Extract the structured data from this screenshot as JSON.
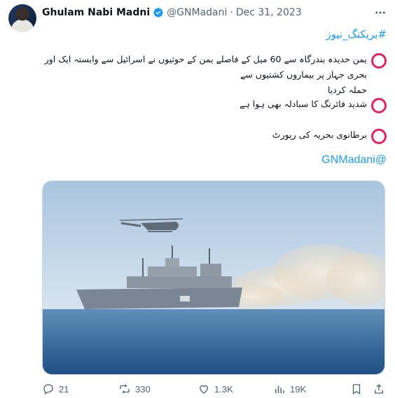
{
  "post": {
    "author_name": "Ghulam Nabi Madni",
    "handle": "@GNMadani",
    "separator": "·",
    "date": "Dec 31, 2023",
    "hashtag": "#بریکنگ_نیوز",
    "lines": [
      "یمن حدیدہ بندرگاہ سے 60 میل کے فاصلے یمن کے حوثیوں نے اسرائیل سے وابستہ ایک اور بحری جہاز پر بیماروں کشتیوں سے",
      "حملہ کردیا",
      "شدید فائرنگ کا سبادلہ بھی ہوا ہے",
      "برطانوی بحریہ کی رپورٹ"
    ],
    "mention": "GNMadani@"
  },
  "actions": {
    "replies": "21",
    "reposts": "330",
    "likes": "1.3K",
    "views": "19K"
  },
  "icons": [
    "verified-badge-icon",
    "more-icon",
    "reply-icon",
    "repost-icon",
    "like-icon",
    "views-icon",
    "bookmark-icon",
    "share-icon"
  ],
  "colors": {
    "accent": "#1d9bf0",
    "bullet_circle": "#e0245e",
    "muted": "#536471"
  }
}
